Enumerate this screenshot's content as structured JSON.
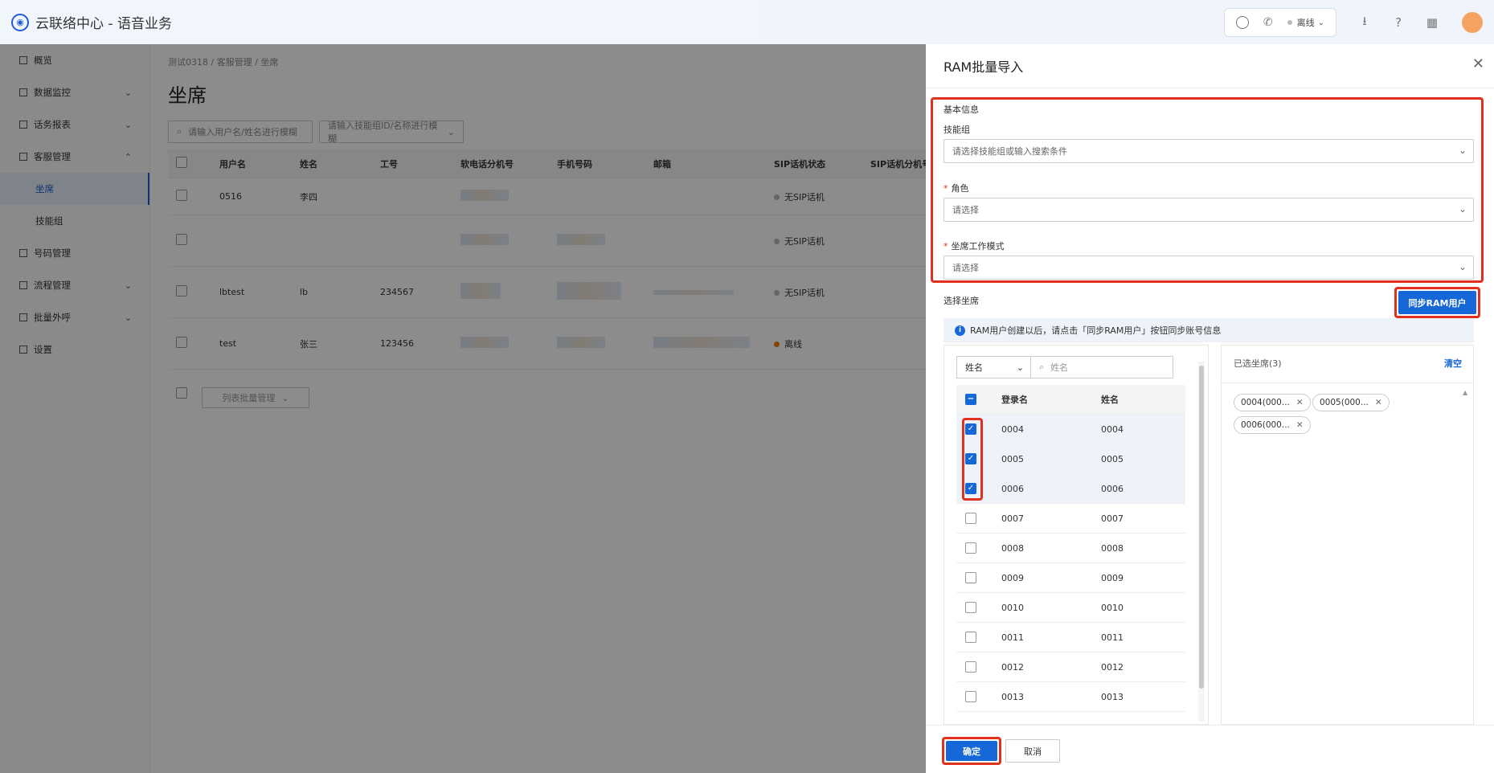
{
  "app": {
    "title": "云联络中心 - 语音业务",
    "logo_glyph": "◉"
  },
  "topbar": {
    "status": "离线"
  },
  "sidebar": {
    "items": [
      {
        "label": "概览",
        "chevron": ""
      },
      {
        "label": "数据监控",
        "chevron": "⌄"
      },
      {
        "label": "话务报表",
        "chevron": "⌄"
      },
      {
        "label": "客服管理",
        "chevron": "⌃"
      },
      {
        "label": "坐席",
        "chevron": ""
      },
      {
        "label": "技能组",
        "chevron": ""
      },
      {
        "label": "号码管理",
        "chevron": ""
      },
      {
        "label": "流程管理",
        "chevron": "⌄"
      },
      {
        "label": "批量外呼",
        "chevron": "⌄"
      },
      {
        "label": "设置",
        "chevron": ""
      }
    ]
  },
  "content": {
    "breadcrumb": "测试0318  /  客服管理  /  坐席",
    "title": "坐席",
    "search_placeholder": "请输入用户名/姓名进行模糊",
    "skill_placeholder": "请输入技能组ID/名称进行模糊",
    "columns": [
      "用户名",
      "姓名",
      "工号",
      "软电话分机号",
      "手机号码",
      "邮箱",
      "SIP话机状态",
      "SIP话机分机号"
    ],
    "rows": [
      {
        "username": "0516",
        "name": "李四",
        "jobno": "",
        "sip_status": "无SIP话机"
      },
      {
        "username": "",
        "name": "",
        "jobno": "",
        "sip_status": "无SIP话机"
      },
      {
        "username": "lbtest",
        "name": "lb",
        "jobno": "234567",
        "sip_status": "无SIP话机"
      },
      {
        "username": "test",
        "name": "张三",
        "jobno": "123456",
        "sip_status": "离线"
      }
    ],
    "bulk_action": "列表批量管理"
  },
  "drawer": {
    "title": "RAM批量导入",
    "section_basic": "基本信息",
    "skill_group_label": "技能组",
    "skill_group_placeholder": "请选择技能组或输入搜索条件",
    "role_label": "角色",
    "role_placeholder": "请选择",
    "mode_label": "坐席工作模式",
    "mode_placeholder": "请选择",
    "select_agents_label": "选择坐席",
    "sync_button": "同步RAM用户",
    "info_text": "RAM用户创建以后，请点击「同步RAM用户」按钮同步账号信息",
    "filter_field": "姓名",
    "filter_placeholder": "姓名",
    "list_columns": [
      "登录名",
      "姓名"
    ],
    "list_rows": [
      {
        "login": "0004",
        "name": "0004",
        "checked": true
      },
      {
        "login": "0005",
        "name": "0005",
        "checked": true
      },
      {
        "login": "0006",
        "name": "0006",
        "checked": true
      },
      {
        "login": "0007",
        "name": "0007",
        "checked": false
      },
      {
        "login": "0008",
        "name": "0008",
        "checked": false
      },
      {
        "login": "0009",
        "name": "0009",
        "checked": false
      },
      {
        "login": "0010",
        "name": "0010",
        "checked": false
      },
      {
        "login": "0011",
        "name": "0011",
        "checked": false
      },
      {
        "login": "0012",
        "name": "0012",
        "checked": false
      },
      {
        "login": "0013",
        "name": "0013",
        "checked": false
      }
    ],
    "selected_title": "已选坐席(3)",
    "clear_label": "清空",
    "selected_tags": [
      "0004(000...",
      "0005(000...",
      "0006(000..."
    ],
    "confirm": "确定",
    "cancel": "取消"
  },
  "colors": {
    "primary": "#1668d8",
    "highlight": "#e0301e",
    "offline": "#f57c00"
  }
}
